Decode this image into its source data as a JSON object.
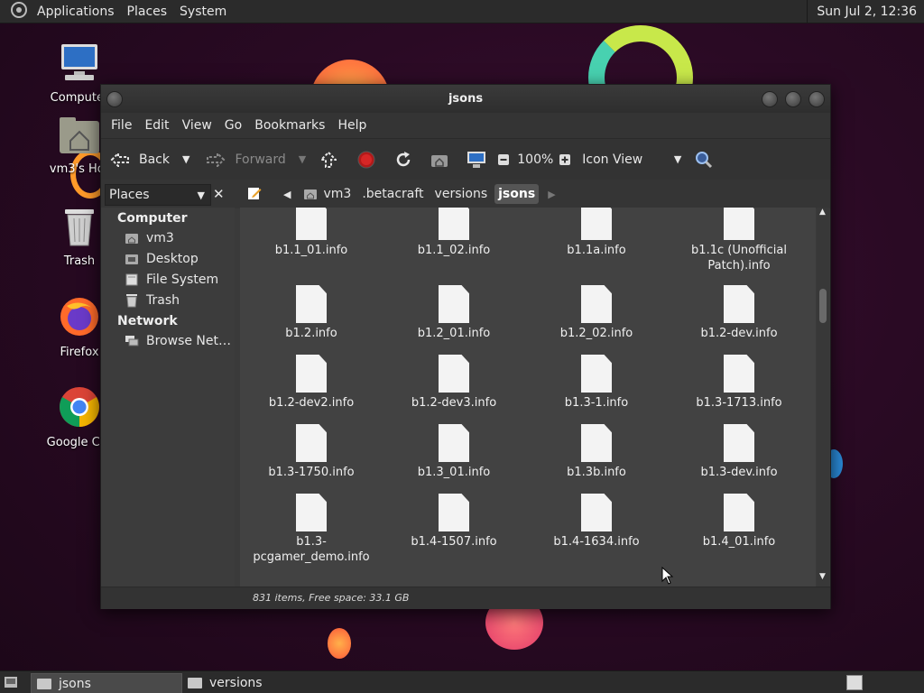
{
  "top_panel": {
    "menus": [
      "Applications",
      "Places",
      "System"
    ],
    "clock": "Sun Jul  2, 12:36"
  },
  "desktop_icons": [
    {
      "label": "Computer",
      "icon": "computer-icon"
    },
    {
      "label": "vm3's Hor",
      "icon": "home-folder-icon"
    },
    {
      "label": "Trash",
      "icon": "trash-icon"
    },
    {
      "label": "Firefox",
      "icon": "firefox-icon"
    },
    {
      "label": "Google Chr",
      "icon": "chrome-icon"
    }
  ],
  "window": {
    "title": "jsons",
    "menubar": [
      "File",
      "Edit",
      "View",
      "Go",
      "Bookmarks",
      "Help"
    ],
    "toolbar": {
      "back": "Back",
      "forward": "Forward",
      "zoom": "100%",
      "view_mode": "Icon View"
    },
    "sidepane_selector": "Places",
    "breadcrumbs": [
      "vm3",
      ".betacraft",
      "versions",
      "jsons"
    ],
    "sidebar": {
      "computer_heading": "Computer",
      "computer_items": [
        "vm3",
        "Desktop",
        "File System",
        "Trash"
      ],
      "network_heading": "Network",
      "network_items": [
        "Browse Net…"
      ]
    },
    "files": [
      "b1.1_01.info",
      "b1.1_02.info",
      "b1.1a.info",
      "b1.1c (Unofficial Patch).info",
      "b1.2.info",
      "b1.2_01.info",
      "b1.2_02.info",
      "b1.2-dev.info",
      "b1.2-dev2.info",
      "b1.2-dev3.info",
      "b1.3-1.info",
      "b1.3-1713.info",
      "b1.3-1750.info",
      "b1.3_01.info",
      "b1.3b.info",
      "b1.3-dev.info",
      "b1.3-pcgamer_demo.info",
      "b1.4-1507.info",
      "b1.4-1634.info",
      "b1.4_01.info"
    ],
    "status": "831 items, Free space: 33.1 GB"
  },
  "taskbar": [
    "jsons",
    "versions"
  ]
}
